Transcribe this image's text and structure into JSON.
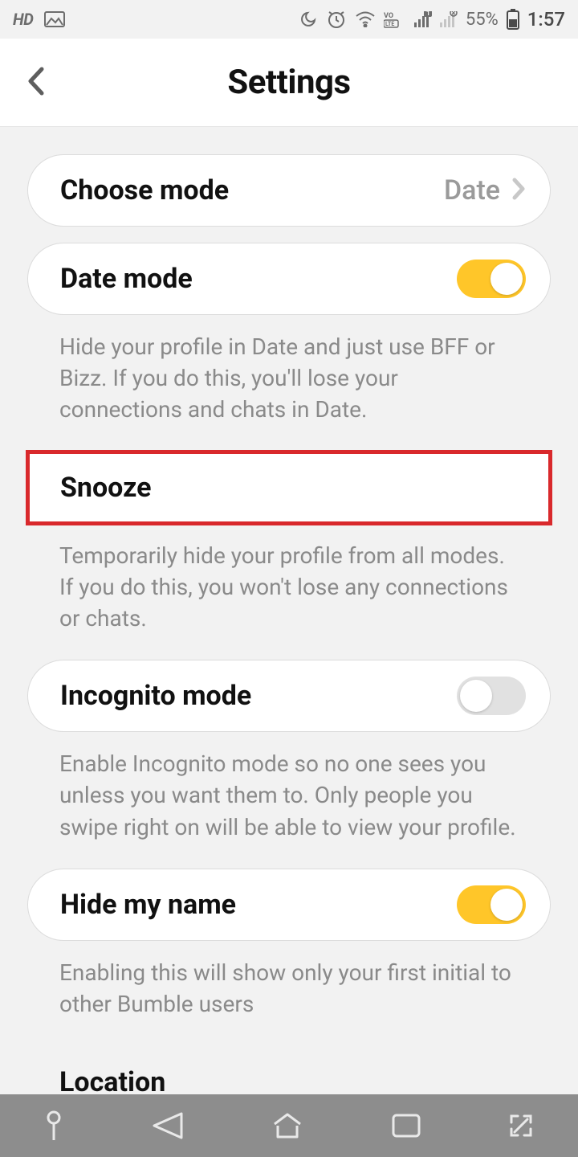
{
  "statusbar": {
    "hd": "HD",
    "battery": "55%",
    "time": "1:57"
  },
  "header": {
    "title": "Settings"
  },
  "chooseMode": {
    "label": "Choose mode",
    "value": "Date"
  },
  "dateMode": {
    "label": "Date mode",
    "desc": "Hide your profile in Date and just use BFF or Bizz. If you do this, you'll lose your connections and chats in Date.",
    "on": true
  },
  "snooze": {
    "label": "Snooze",
    "desc": "Temporarily hide your profile from all modes. If you do this, you won't lose any connections or chats."
  },
  "incognito": {
    "label": "Incognito mode",
    "desc": "Enable Incognito mode so no one sees you unless you want them to. Only people you swipe right on will be able to view your profile.",
    "on": false
  },
  "hideName": {
    "label": "Hide my name",
    "desc": "Enabling this will show only your first initial to other Bumble users",
    "on": true
  },
  "location": {
    "label": "Location"
  },
  "colors": {
    "accent": "#ffc629",
    "highlight": "#d9292c"
  }
}
